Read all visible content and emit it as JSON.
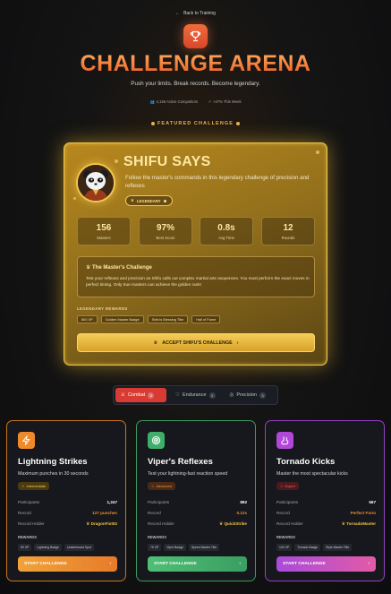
{
  "nav": {
    "back_label": "Back to Training"
  },
  "header": {
    "title": "CHALLENGE ARENA",
    "subtitle": "Push your limits. Break records. Become legendary.",
    "active_label": "2,156 Active Competitors",
    "growth_label": "+47% This Week",
    "featured_label": "FEATURED CHALLENGE"
  },
  "featured": {
    "title": "SHIFU SAYS",
    "description": "Follow the master's commands in this legendary challenge of precision and reflexes",
    "badge": "LEGENDARY",
    "stats": [
      {
        "value": "156",
        "label": "Masters"
      },
      {
        "value": "97%",
        "label": "Best Score"
      },
      {
        "value": "0.8s",
        "label": "Avg Time"
      },
      {
        "value": "12",
        "label": "Rounds"
      }
    ],
    "challenge_heading": "The Master's Challenge",
    "challenge_text": "Test your reflexes and precision as Shifu calls out complex martial arts sequences. You must perform the exact moves in perfect timing. Only true masters can achieve the golden rank!",
    "rewards_label": "LEGENDARY REWARDS",
    "rewards": [
      "500 XP",
      "Golden Master Badge",
      "Shifu's Blessing Title",
      "Hall of Fame"
    ],
    "accept_label": "ACCEPT SHIFU'S CHALLENGE"
  },
  "tabs": [
    {
      "label": "Combat",
      "count": "3"
    },
    {
      "label": "Endurance",
      "count": "3"
    },
    {
      "label": "Precision",
      "count": "3"
    }
  ],
  "cards": [
    {
      "title": "Lightning Strikes",
      "description": "Maximum punches in 30 seconds",
      "level": "Intermediate",
      "participants_label": "Participants",
      "participants": "1,247",
      "record_label": "Record",
      "record": "127 punches",
      "holder_label": "Record Holder",
      "holder": "DragonFist92",
      "rewards_label": "REWARDS",
      "rewards": [
        "50 XP",
        "Lightning Badge",
        "Leaderboard Spot"
      ],
      "button": "START CHALLENGE",
      "accent": "#f08a2c"
    },
    {
      "title": "Viper's Reflexes",
      "description": "Test your lightning-fast reaction speed",
      "level": "Advanced",
      "participants_label": "Participants",
      "participants": "892",
      "record_label": "Record",
      "record": "0.12s",
      "holder_label": "Record Holder",
      "holder": "QuickStrike",
      "rewards_label": "REWARDS",
      "rewards": [
        "75 XP",
        "Viper Badge",
        "Speed Master Title"
      ],
      "button": "START CHALLENGE",
      "accent": "#3fae6a"
    },
    {
      "title": "Tornado Kicks",
      "description": "Master the most spectacular kicks",
      "level": "Expert",
      "participants_label": "Participants",
      "participants": "567",
      "record_label": "Record",
      "record": "Perfect Form",
      "holder_label": "Record Holder",
      "holder": "TornadoMaster",
      "rewards_label": "REWARDS",
      "rewards": [
        "100 XP",
        "Tornado Badge",
        "Style Master Title"
      ],
      "button": "START CHALLENGE",
      "accent": "#a43fd4"
    }
  ]
}
